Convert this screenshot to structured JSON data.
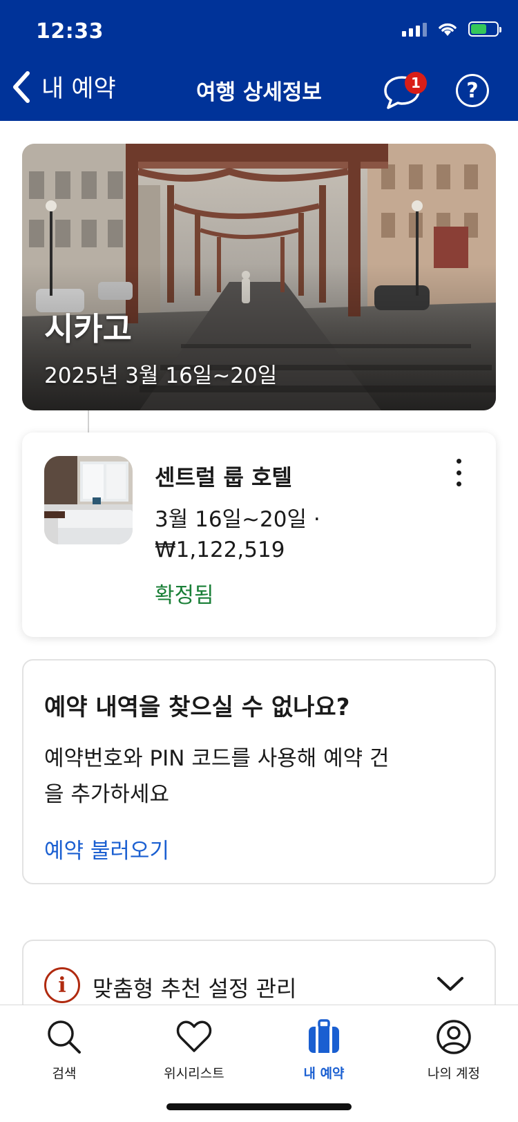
{
  "status_bar": {
    "time": "12:33"
  },
  "header": {
    "back_label": "내 예약",
    "title": "여행 상세정보",
    "message_badge": "1",
    "help_label": "?"
  },
  "trip": {
    "city": "시카고",
    "dates": "2025년 3월 16일~20일"
  },
  "hotel": {
    "name": "센트럴 룹 호텔",
    "dates": "3월 16일~20일 ·",
    "price": "₩1,122,519",
    "status": "확정됨"
  },
  "find_booking": {
    "title": "예약 내역을 찾으실 수 없나요?",
    "description": "예약번호와 PIN 코드를 사용해 예약 건을 추가하세요",
    "link": "예약 불러오기"
  },
  "recommendation": {
    "icon_text": "i",
    "label": "맞춤형 추천 설정 관리"
  },
  "bottom_nav": {
    "tabs": [
      {
        "label": "검색",
        "icon": "search-icon"
      },
      {
        "label": "위시리스트",
        "icon": "heart-icon"
      },
      {
        "label": "내 예약",
        "icon": "suitcase-icon"
      },
      {
        "label": "나의 계정",
        "icon": "account-icon"
      }
    ]
  },
  "colors": {
    "header_bg": "#003399",
    "accent_blue": "#1a5fd1",
    "confirmed_green": "#1a7f37",
    "badge_red": "#d91e18",
    "info_red": "#b02a0f"
  }
}
